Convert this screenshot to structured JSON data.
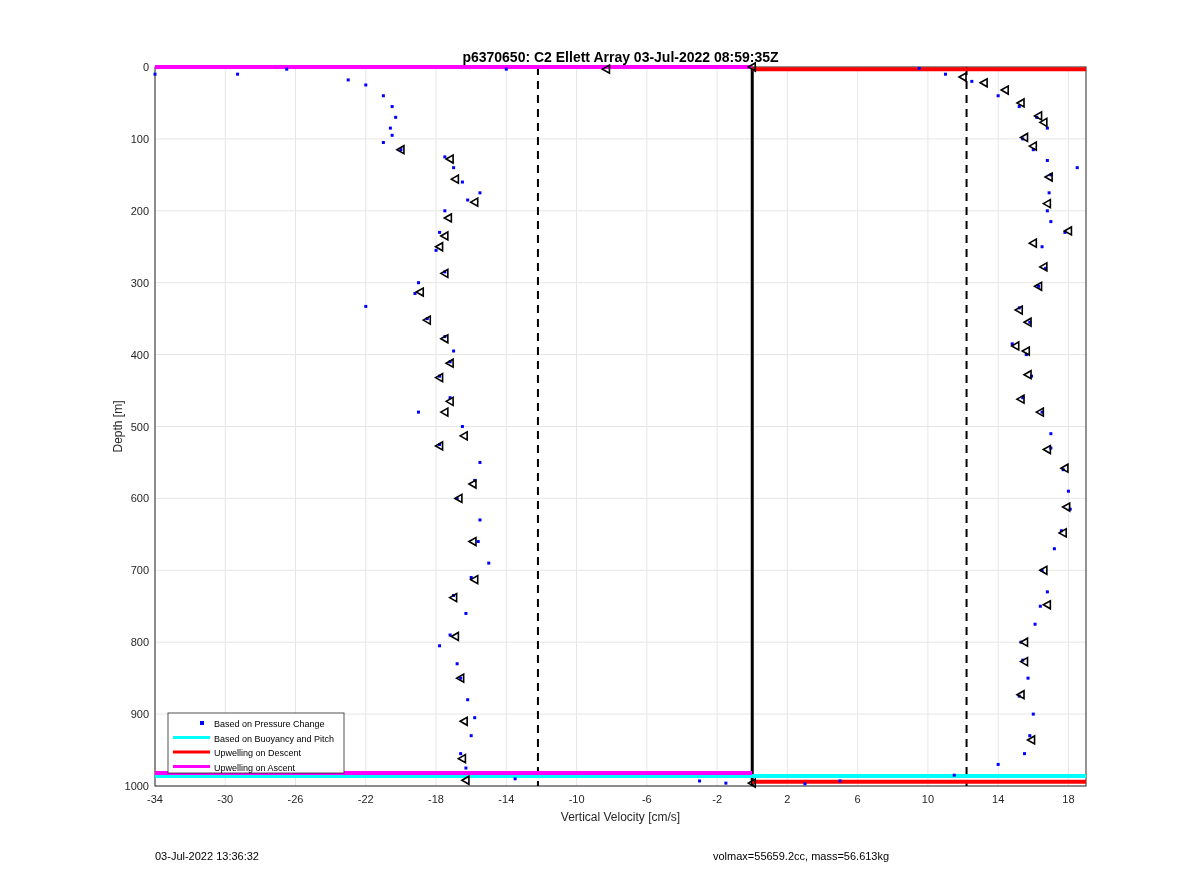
{
  "chart_data": {
    "type": "scatter",
    "title": "p6370650: C2 Ellett Array 03-Jul-2022 08:59:35Z",
    "xlabel": "Vertical Velocity [cm/s]",
    "ylabel": "Depth [m]",
    "xlim": [
      -34,
      19
    ],
    "ylim": [
      1000,
      0
    ],
    "xticks": [
      -34,
      -30,
      -26,
      -22,
      -18,
      -14,
      -10,
      -6,
      -2,
      2,
      6,
      10,
      14,
      18
    ],
    "yticks": [
      0,
      100,
      200,
      300,
      400,
      500,
      600,
      700,
      800,
      900,
      1000
    ],
    "series": [
      {
        "name": "Based on Pressure Change",
        "color": "#0000ff",
        "x": [
          -34,
          -29.3,
          -26.5,
          -23,
          -22,
          -21,
          -20.5,
          -20.3,
          -20.6,
          -20.5,
          -21,
          -20,
          -17.5,
          -17,
          -16.5,
          -15.5,
          -16.2,
          -17.5,
          -17.8,
          -18,
          -17.5,
          -19,
          -19.2,
          -22,
          -18.5,
          -17.5,
          -17,
          -17.2,
          -17.8,
          -17.2,
          -19,
          -16.5,
          -17.8,
          -15.5,
          -15.8,
          -16.8,
          -15.5,
          -15.6,
          -15,
          -16,
          -17,
          -16.3,
          -17.2,
          -17.8,
          -16.8,
          -16.6,
          -16.2,
          -15.8,
          -16,
          -16.6,
          -16.3,
          -13.5,
          -3,
          -1.5,
          -14,
          9.5,
          11,
          12.5,
          14,
          15.2,
          16.2,
          16.8,
          15.4,
          16,
          16.8,
          18.5,
          17,
          16.9,
          16.8,
          17,
          17.8,
          16.5,
          16.7,
          16.3,
          15.2,
          15.8,
          14.8,
          15.6,
          15.9,
          15.4,
          16.5,
          17,
          17,
          17.7,
          18,
          18.1,
          17.6,
          17.2,
          16.5,
          16.8,
          16.4,
          16.1,
          15.3,
          15.4,
          15.7,
          15.2,
          16,
          15.8,
          15.5,
          14,
          11.5,
          5,
          3
        ],
        "values": [
          10,
          10,
          3,
          18,
          25,
          40,
          55,
          70,
          85,
          95,
          105,
          115,
          125,
          140,
          160,
          175,
          185,
          200,
          230,
          255,
          285,
          300,
          315,
          333,
          350,
          375,
          395,
          410,
          430,
          460,
          480,
          500,
          525,
          550,
          575,
          600,
          630,
          660,
          690,
          710,
          735,
          760,
          790,
          805,
          830,
          850,
          880,
          905,
          930,
          955,
          975,
          990,
          993,
          996,
          3,
          2,
          10,
          20,
          40,
          55,
          70,
          85,
          100,
          115,
          130,
          140,
          150,
          175,
          200,
          215,
          230,
          250,
          280,
          305,
          335,
          355,
          385,
          400,
          430,
          460,
          480,
          510,
          530,
          560,
          590,
          615,
          645,
          670,
          700,
          730,
          750,
          775,
          800,
          825,
          850,
          875,
          900,
          930,
          955,
          970,
          985,
          993,
          997
        ]
      },
      {
        "name": "Based on Buoyancy and Pitch",
        "type": "line",
        "color": "#00ffff",
        "x": [
          -34,
          19
        ],
        "values": [
          986,
          986
        ]
      },
      {
        "name": "Upwelling on Descent",
        "type": "line",
        "color": "#ff0000",
        "x": [
          0,
          19
        ],
        "values": [
          994,
          994
        ]
      },
      {
        "name": "Upwelling on Ascent",
        "type": "line",
        "color": "#ff00ff",
        "x": [
          -34,
          0
        ],
        "values": [
          982,
          982
        ]
      },
      {
        "type": "line",
        "color": "#ff0000",
        "x": [
          0,
          19
        ],
        "values": [
          3,
          3
        ]
      },
      {
        "type": "line",
        "color": "#ff00ff",
        "x": [
          -34,
          0
        ],
        "values": [
          0,
          0
        ]
      },
      {
        "color": "#000000",
        "x": [
          -20,
          -17.2,
          -16.9,
          -15.8,
          -17.3,
          -17.5,
          -17.8,
          -17.5,
          -18.9,
          -18.5,
          -17.5,
          -17.2,
          -17.8,
          -17.2,
          -17.5,
          -16.4,
          -17.8,
          -15.9,
          -16.7,
          -15.9,
          -15.8,
          -17,
          -16.9,
          -16.6,
          -16.4,
          -16.5,
          -16.3,
          -8.3,
          0,
          0,
          12,
          13.2,
          14.4,
          15.3,
          16.3,
          16.6,
          15.5,
          16,
          16.9,
          16.8,
          18,
          16,
          16.6,
          16.3,
          15.2,
          15.7,
          15,
          15.6,
          15.7,
          15.3,
          16.4,
          16.8,
          17.8,
          17.9,
          17.7,
          16.6,
          16.8,
          15.5,
          15.5,
          15.3,
          15.9
        ],
        "values": [
          115,
          128,
          156,
          188,
          210,
          235,
          250,
          287,
          313,
          352,
          378,
          412,
          432,
          465,
          480,
          513,
          527,
          580,
          600,
          660,
          713,
          738,
          792,
          850,
          910,
          962,
          992,
          3,
          0,
          996,
          14,
          22,
          32,
          50,
          68,
          77,
          98,
          110,
          153,
          190,
          228,
          245,
          278,
          305,
          338,
          355,
          388,
          395,
          428,
          462,
          480,
          532,
          558,
          612,
          648,
          700,
          748,
          800,
          827,
          873,
          936
        ]
      }
    ],
    "ref_lines": [
      {
        "axis": "x",
        "value": -12.2
      },
      {
        "axis": "x",
        "value": 0
      },
      {
        "axis": "x",
        "value": 12.2
      }
    ],
    "grid": true,
    "legend": true
  },
  "footer": {
    "timestamp": "03-Jul-2022 13:36:32",
    "summary": "volmax=55659.2cc, mass=56.613kg"
  }
}
